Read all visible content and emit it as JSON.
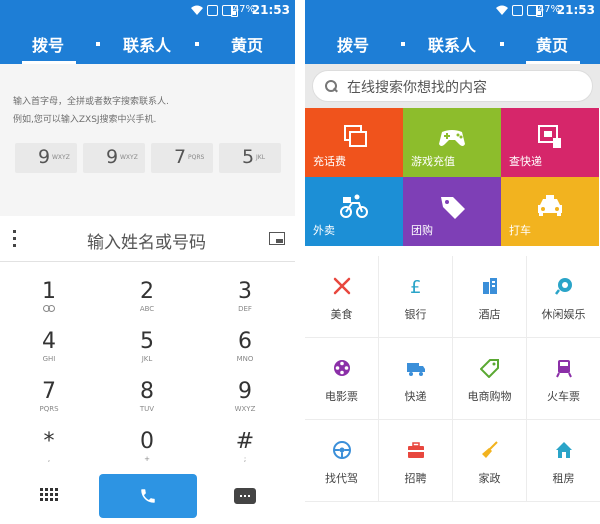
{
  "status": {
    "battery": "47%",
    "time": "21:53"
  },
  "tabs": [
    {
      "label": "拨号"
    },
    {
      "label": "联系人"
    },
    {
      "label": "黄页"
    }
  ],
  "dialer": {
    "hint_line1": "输入首字母，全拼或者数字搜索联系人.",
    "hint_line2": "例如,您可以输入ZXSJ搜索中兴手机.",
    "chips": [
      {
        "digit": "9",
        "letters": "WXYZ"
      },
      {
        "digit": "9",
        "letters": "WXYZ"
      },
      {
        "digit": "7",
        "letters": "PQRS"
      },
      {
        "digit": "5",
        "letters": "JKL"
      }
    ],
    "input_placeholder": "输入姓名或号码",
    "keys": [
      {
        "digit": "1",
        "letters": ""
      },
      {
        "digit": "2",
        "letters": "ABC"
      },
      {
        "digit": "3",
        "letters": "DEF"
      },
      {
        "digit": "4",
        "letters": "GHI"
      },
      {
        "digit": "5",
        "letters": "JKL"
      },
      {
        "digit": "6",
        "letters": "MNO"
      },
      {
        "digit": "7",
        "letters": "PQRS"
      },
      {
        "digit": "8",
        "letters": "TUV"
      },
      {
        "digit": "9",
        "letters": "WXYZ"
      },
      {
        "digit": "*",
        "letters": ","
      },
      {
        "digit": "0",
        "letters": "+"
      },
      {
        "digit": "#",
        "letters": ";"
      }
    ]
  },
  "yellowpages": {
    "search_placeholder": "在线搜索你想找的内容",
    "tiles": [
      {
        "label": "充话费",
        "color": "#f0531c",
        "icon": "recharge-icon"
      },
      {
        "label": "游戏充值",
        "color": "#8dbd2c",
        "icon": "gamepad-icon"
      },
      {
        "label": "查快递",
        "color": "#d6266a",
        "icon": "parcel-icon"
      },
      {
        "label": "外卖",
        "color": "#1c8fd6",
        "icon": "delivery-bike-icon"
      },
      {
        "label": "团购",
        "color": "#7e3fb6",
        "icon": "tag-icon"
      },
      {
        "label": "打车",
        "color": "#f2b31f",
        "icon": "taxi-icon"
      }
    ],
    "categories": [
      {
        "label": "美食",
        "icon": "food-icon",
        "color": "#e8473e"
      },
      {
        "label": "银行",
        "icon": "bank-icon",
        "color": "#2aa4c8"
      },
      {
        "label": "酒店",
        "icon": "hotel-icon",
        "color": "#3b8fd9"
      },
      {
        "label": "休闲娱乐",
        "icon": "leisure-icon",
        "color": "#2aa4c8"
      },
      {
        "label": "电影票",
        "icon": "film-reel-icon",
        "color": "#8b2fa8"
      },
      {
        "label": "快递",
        "icon": "truck-icon",
        "color": "#3b8fd9"
      },
      {
        "label": "电商购物",
        "icon": "shopping-tag-icon",
        "color": "#5aa832"
      },
      {
        "label": "火车票",
        "icon": "train-icon",
        "color": "#8b2fa8"
      },
      {
        "label": "找代驾",
        "icon": "steering-wheel-icon",
        "color": "#3b8fd9"
      },
      {
        "label": "招聘",
        "icon": "briefcase-icon",
        "color": "#e8473e"
      },
      {
        "label": "家政",
        "icon": "broom-icon",
        "color": "#f2b31f"
      },
      {
        "label": "租房",
        "icon": "house-icon",
        "color": "#2aa4c8"
      }
    ]
  }
}
